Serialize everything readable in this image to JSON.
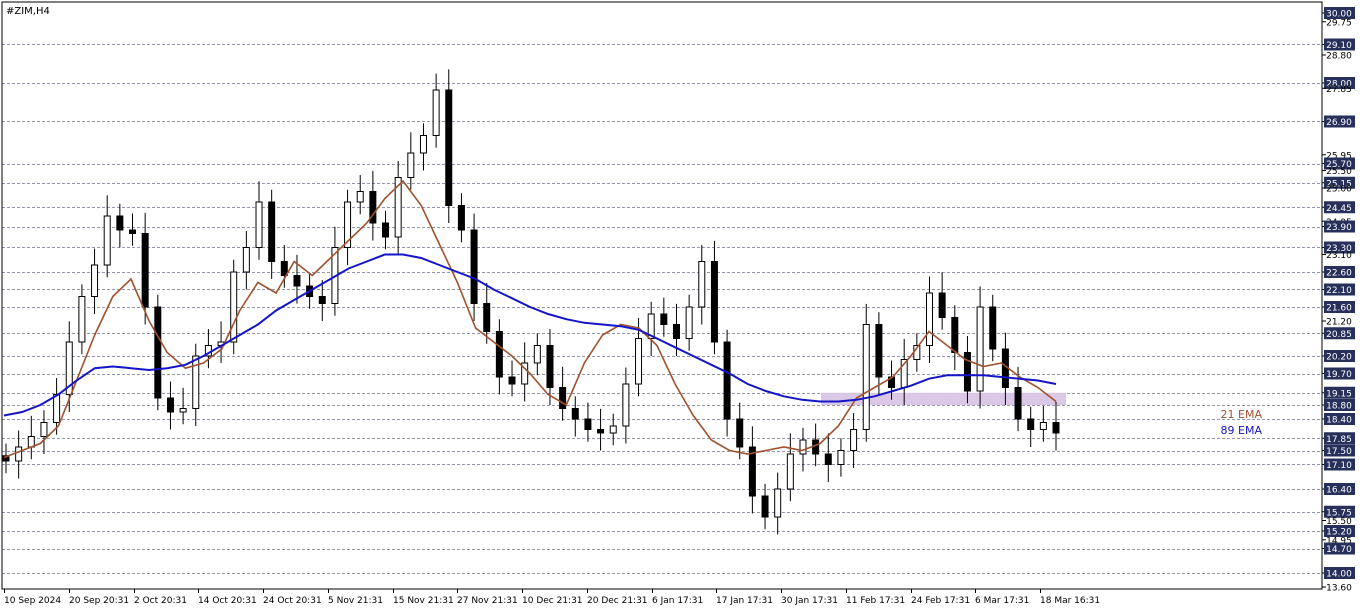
{
  "chart_data": {
    "type": "candlestick",
    "title": "#ZIM,H4",
    "ylim": [
      13.6,
      30.0
    ],
    "y_ticks": [
      30.0,
      29.75,
      29.1,
      28.8,
      28.0,
      27.85,
      26.9,
      25.95,
      25.7,
      25.5,
      25.15,
      25.0,
      24.45,
      24.05,
      23.9,
      23.3,
      23.1,
      22.6,
      22.1,
      21.6,
      21.2,
      20.85,
      20.2,
      19.7,
      19.15,
      18.8,
      18.4,
      17.85,
      17.5,
      17.1,
      16.4,
      15.75,
      15.5,
      15.2,
      14.95,
      14.7,
      14.0,
      13.6
    ],
    "level_lines": [
      29.1,
      28.0,
      26.9,
      25.7,
      25.15,
      24.45,
      23.9,
      23.3,
      22.6,
      22.1,
      21.6,
      20.85,
      20.2,
      19.7,
      19.15,
      18.8,
      18.4,
      17.85,
      17.5,
      17.1,
      16.4,
      15.75,
      15.2,
      14.7,
      14.0
    ],
    "boxed_levels": [
      30.0,
      29.1,
      28.0,
      26.9,
      25.7,
      25.15,
      24.45,
      23.9,
      23.3,
      22.6,
      22.1,
      21.6,
      20.85,
      20.2,
      19.7,
      19.15,
      18.8,
      18.4,
      17.85,
      17.5,
      17.1,
      16.4,
      15.75,
      15.2,
      14.7,
      14.0
    ],
    "x_labels": [
      "10 Sep 2024",
      "20 Sep 20:31",
      "2 Oct 20:31",
      "14 Oct 20:31",
      "24 Oct 20:31",
      "5 Nov 21:31",
      "15 Nov 21:31",
      "27 Nov 21:31",
      "10 Dec 21:31",
      "20 Dec 21:31",
      "6 Jan 17:31",
      "17 Jan 17:31",
      "30 Jan 17:31",
      "11 Feb 17:31",
      "24 Feb 17:31",
      "6 Mar 17:31",
      "18 Mar 16:31"
    ],
    "zone": {
      "from": 18.8,
      "to": 19.15,
      "start_label": "30 Jan 17:31"
    },
    "series": [
      {
        "name": "21 EMA",
        "color": "#a0522d",
        "values": [
          17.3,
          17.5,
          17.7,
          18.2,
          19.5,
          20.8,
          21.9,
          22.4,
          21.2,
          20.3,
          19.85,
          20.0,
          20.4,
          21.5,
          22.3,
          22.0,
          22.9,
          22.5,
          23.0,
          23.5,
          24.0,
          24.7,
          25.2,
          24.5,
          23.4,
          22.3,
          21.0,
          20.6,
          20.2,
          19.7,
          19.1,
          18.8,
          20.0,
          20.8,
          21.1,
          21.0,
          20.5,
          19.4,
          18.5,
          17.8,
          17.5,
          17.4,
          17.5,
          17.6,
          17.5,
          17.7,
          18.2,
          19.0,
          19.3,
          19.6,
          20.2,
          20.9,
          20.5,
          20.1,
          19.9,
          20.0,
          19.6,
          19.3,
          18.9
        ]
      },
      {
        "name": "89 EMA",
        "color": "#1515c8",
        "values": [
          18.5,
          18.6,
          18.8,
          19.1,
          19.5,
          19.85,
          19.9,
          19.85,
          19.8,
          19.85,
          19.95,
          20.2,
          20.5,
          20.8,
          21.1,
          21.5,
          21.8,
          22.1,
          22.4,
          22.7,
          22.9,
          23.1,
          23.1,
          23.0,
          22.8,
          22.6,
          22.4,
          22.1,
          21.85,
          21.6,
          21.4,
          21.25,
          21.15,
          21.1,
          21.05,
          20.95,
          20.7,
          20.45,
          20.2,
          19.95,
          19.7,
          19.4,
          19.2,
          19.05,
          18.95,
          18.9,
          18.9,
          18.95,
          19.05,
          19.2,
          19.35,
          19.55,
          19.65,
          19.65,
          19.65,
          19.6,
          19.55,
          19.5,
          19.4
        ]
      }
    ],
    "candles_close": [
      17.2,
      17.6,
      17.9,
      18.3,
      19.1,
      20.6,
      21.9,
      22.8,
      24.2,
      23.8,
      23.7,
      21.6,
      19.0,
      18.6,
      18.7,
      20.2,
      20.5,
      20.6,
      22.6,
      23.3,
      24.6,
      22.9,
      22.5,
      22.2,
      21.9,
      21.7,
      23.3,
      24.6,
      24.9,
      24.0,
      23.6,
      25.3,
      26.0,
      26.5,
      27.8,
      24.5,
      23.8,
      21.7,
      20.9,
      19.6,
      19.4,
      20.0,
      20.5,
      19.3,
      18.7,
      18.4,
      18.1,
      18.0,
      18.2,
      19.4,
      20.7,
      21.4,
      21.1,
      20.7,
      21.6,
      22.9,
      20.6,
      18.4,
      17.6,
      16.2,
      15.6,
      16.4,
      17.4,
      17.8,
      17.4,
      17.1,
      17.5,
      18.1,
      21.1,
      19.6,
      19.3,
      20.1,
      20.5,
      22.0,
      21.3,
      20.3,
      19.2,
      21.6,
      20.4,
      19.3,
      18.4,
      18.1,
      18.3,
      18.0
    ]
  },
  "legend": {
    "ema21": "21 EMA",
    "ema89": "89 EMA"
  }
}
